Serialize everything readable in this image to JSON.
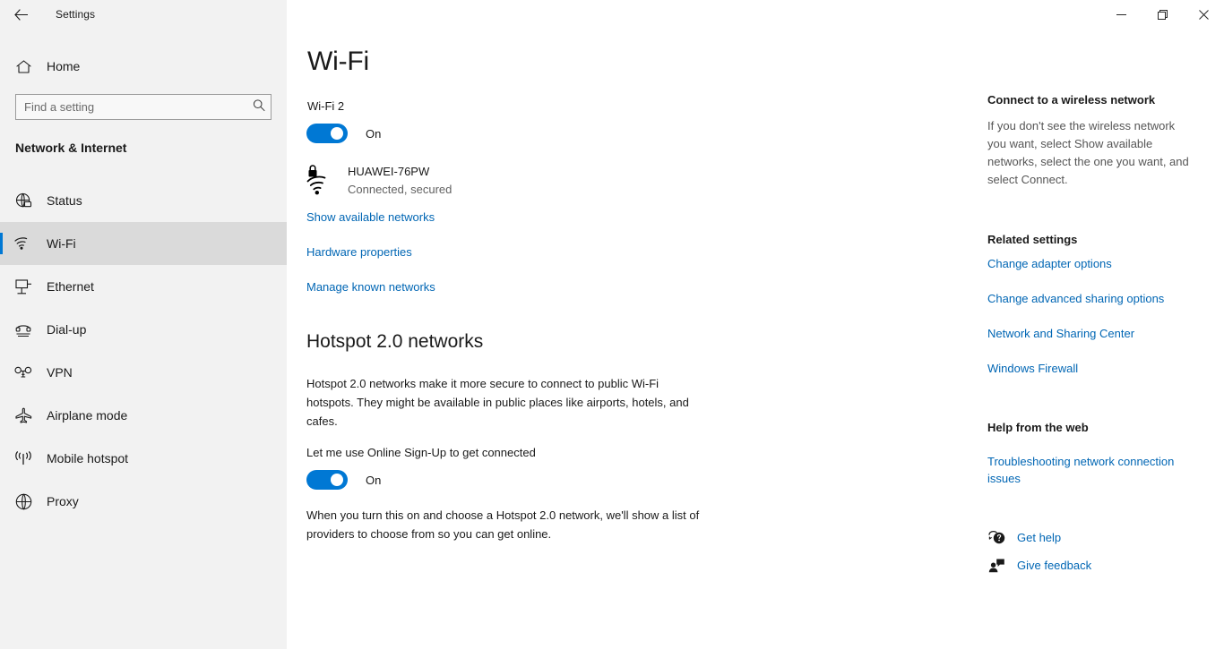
{
  "window": {
    "title": "Settings",
    "back_icon": "back-arrow-icon",
    "minimize_label": "–",
    "maximize_label": "❐",
    "close_label": "✕"
  },
  "sidebar": {
    "home_label": "Home",
    "home_icon": "home-icon",
    "search": {
      "placeholder": "Find a setting",
      "value": "",
      "icon": "search-icon"
    },
    "category": "Network & Internet",
    "items": [
      {
        "label": "Status",
        "icon": "status-globe-icon",
        "selected": false
      },
      {
        "label": "Wi-Fi",
        "icon": "wifi-icon",
        "selected": true
      },
      {
        "label": "Ethernet",
        "icon": "ethernet-icon",
        "selected": false
      },
      {
        "label": "Dial-up",
        "icon": "dialup-phone-icon",
        "selected": false
      },
      {
        "label": "VPN",
        "icon": "vpn-key-icon",
        "selected": false
      },
      {
        "label": "Airplane mode",
        "icon": "airplane-icon",
        "selected": false
      },
      {
        "label": "Mobile hotspot",
        "icon": "mobile-hotspot-icon",
        "selected": false
      },
      {
        "label": "Proxy",
        "icon": "proxy-globe-icon",
        "selected": false
      }
    ]
  },
  "main": {
    "page_title": "Wi-Fi",
    "adapter_label": "Wi-Fi 2",
    "wifi_toggle_state": "On",
    "network": {
      "name": "HUAWEI-76PW",
      "status": "Connected, secured",
      "icon": "wifi-secured-icon"
    },
    "links": [
      "Show available networks",
      "Hardware properties",
      "Manage known networks"
    ],
    "hotspot": {
      "heading": "Hotspot 2.0 networks",
      "description": "Hotspot 2.0 networks make it more secure to connect to public Wi-Fi hotspots. They might be available in public places like airports, hotels, and cafes.",
      "signup_label": "Let me use Online Sign-Up to get connected",
      "signup_toggle_state": "On",
      "note": "When you turn this on and choose a Hotspot 2.0 network, we'll show a list of providers to choose from so you can get online."
    }
  },
  "rail": {
    "connect_heading": "Connect to a wireless network",
    "connect_text": "If you don't see the wireless network you want, select Show available networks, select the one you want, and select Connect.",
    "related_heading": "Related settings",
    "related_links": [
      "Change adapter options",
      "Change advanced sharing options",
      "Network and Sharing Center",
      "Windows Firewall"
    ],
    "help_heading": "Help from the web",
    "help_link": "Troubleshooting network connection issues",
    "get_help": {
      "label": "Get help",
      "icon": "get-help-icon"
    },
    "give_feedback": {
      "label": "Give feedback",
      "icon": "give-feedback-icon"
    }
  },
  "colors": {
    "accent": "#0078d4",
    "link": "#0066b4",
    "sidebar_bg": "#f2f2f2",
    "selected_bg": "#dadada",
    "text": "#1a1a1a",
    "muted": "#565656"
  }
}
